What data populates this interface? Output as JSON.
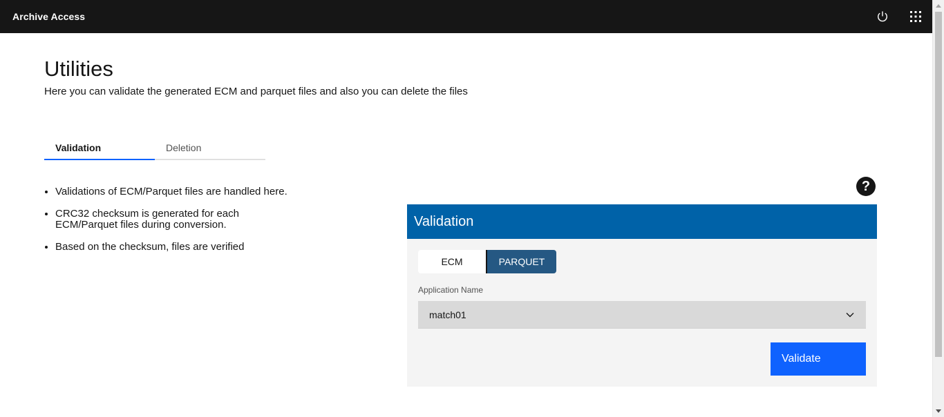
{
  "header": {
    "app_name": "Archive Access",
    "icons": [
      "power-icon",
      "app-switcher-icon"
    ]
  },
  "page": {
    "title": "Utilities",
    "subtitle": "Here you can validate the generated ECM and parquet files and also you can delete the files"
  },
  "tabs": [
    {
      "label": "Validation",
      "active": true
    },
    {
      "label": "Deletion",
      "active": false
    }
  ],
  "info": [
    "Validations of ECM/Parquet files are handled here.",
    "CRC32 checksum is generated for each ECM/Parquet files during conversion.",
    "Based on the checksum, files are verified"
  ],
  "help": {
    "glyph": "?",
    "icon": "help-icon"
  },
  "card": {
    "title": "Validation",
    "switcher": {
      "options": [
        "ECM",
        "PARQUET"
      ],
      "selected": "PARQUET"
    },
    "field_label": "Application Name",
    "select_value": "match01",
    "button_label": "Validate"
  },
  "colors": {
    "topbar": "#161616",
    "accent_blue": "#0f62fe",
    "card_header": "#0062a8",
    "switch_selected": "#255883"
  }
}
